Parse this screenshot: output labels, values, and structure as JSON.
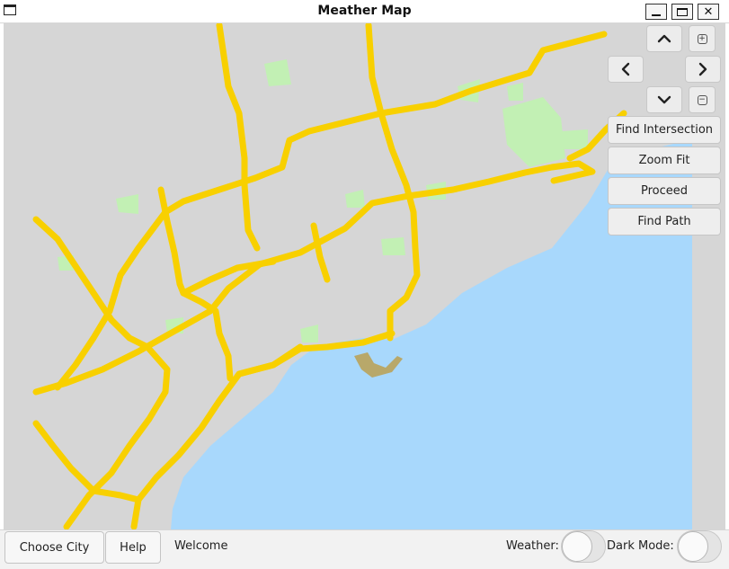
{
  "window": {
    "title": "Meather Map",
    "controls": {
      "minimize": "minimize-icon",
      "maximize": "maximize-icon",
      "close": "✕"
    }
  },
  "map": {
    "colors": {
      "land": "#d6d6d6",
      "water": "#a8d8fc",
      "park": "#c2f0b4",
      "highway": "#f8d000",
      "island": "#b8a86a"
    }
  },
  "navigation": {
    "up_icon": "chevron-up-icon",
    "down_icon": "chevron-down-icon",
    "left_icon": "chevron-left-icon",
    "right_icon": "chevron-right-icon",
    "zoom_in_symbol": "+",
    "zoom_out_symbol": "−"
  },
  "side_buttons": {
    "find_intersection": "Find Intersection",
    "zoom_fit": "Zoom Fit",
    "proceed": "Proceed",
    "find_path": "Find Path"
  },
  "bottom_bar": {
    "choose_city": "Choose City",
    "help": "Help",
    "status": "Welcome",
    "weather_label": "Weather:",
    "dark_mode_label": "Dark Mode:",
    "weather_on": false,
    "dark_mode_on": false
  }
}
